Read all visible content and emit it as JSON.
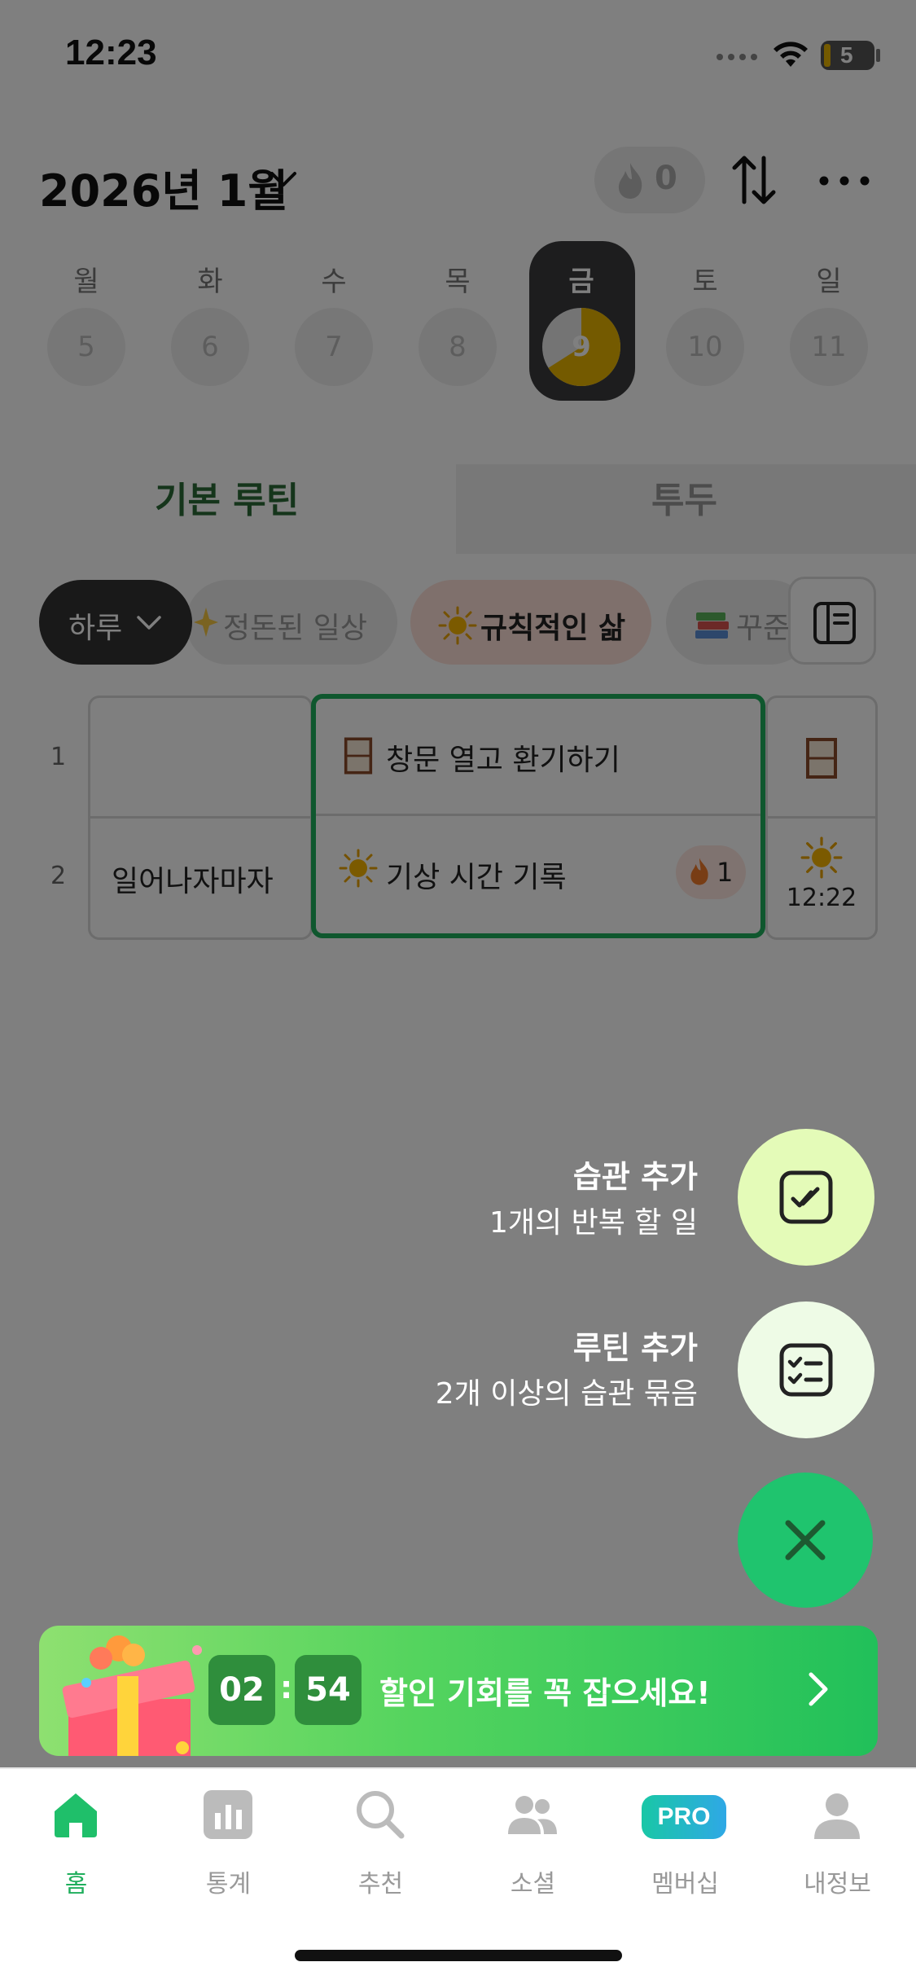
{
  "status_bar": {
    "time": "12:23",
    "battery": "5"
  },
  "header": {
    "month_title": "2026년 1월",
    "streak_count": "0"
  },
  "week": [
    {
      "dow": "월",
      "date": "5"
    },
    {
      "dow": "화",
      "date": "6"
    },
    {
      "dow": "수",
      "date": "7"
    },
    {
      "dow": "목",
      "date": "8"
    },
    {
      "dow": "금",
      "date": "9",
      "active": true,
      "progress": 0.66
    },
    {
      "dow": "토",
      "date": "10"
    },
    {
      "dow": "일",
      "date": "11"
    }
  ],
  "tabs": {
    "basic": "기본 루틴",
    "todo": "투두"
  },
  "chips": {
    "day": "하루",
    "tidy": "정돈된 일상",
    "regular": "규칙적인 삶",
    "steady": "꾸준"
  },
  "grid": {
    "rows": [
      {
        "num": "1",
        "cue": "",
        "habit": "창문 열고 환기하기",
        "habit_icon": "window-icon",
        "check": ""
      },
      {
        "num": "2",
        "cue": "일어나자마자",
        "habit": "기상 시간 기록",
        "habit_icon": "sun-icon",
        "streak": "1",
        "check": "12:22"
      }
    ]
  },
  "fab_menu": {
    "habit": {
      "title": "습관 추가",
      "subtitle": "1개의 반복 할 일"
    },
    "routine": {
      "title": "루틴 추가",
      "subtitle": "2개 이상의 습관 묶음"
    }
  },
  "promo": {
    "minutes": "02",
    "colon": ":",
    "seconds": "54",
    "text": "할인 기회를 꼭 잡으세요!"
  },
  "tabbar": {
    "home": "홈",
    "stats": "통계",
    "recommend": "추천",
    "social": "소셜",
    "membership": "멤버십",
    "pro_badge": "PRO",
    "profile": "내정보"
  },
  "colors": {
    "accent": "#1fae5c",
    "fab": "#1fc46e",
    "active_day": "#3a3a3c",
    "progress": "#e8b400"
  }
}
